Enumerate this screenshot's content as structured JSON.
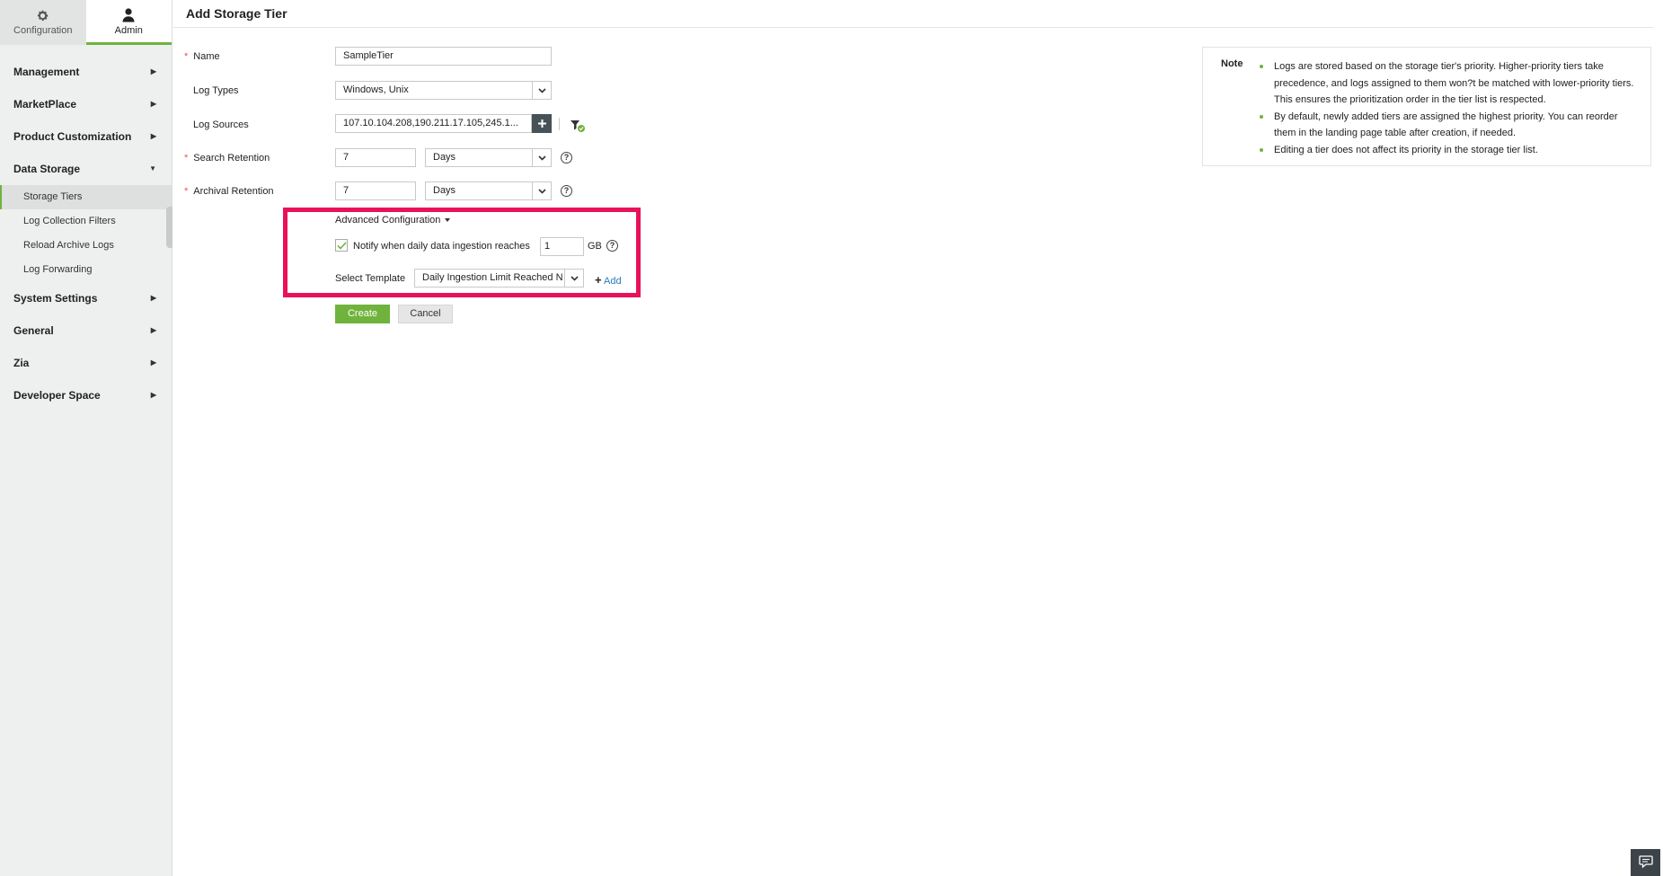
{
  "top_tabs": {
    "configuration": "Configuration",
    "admin": "Admin"
  },
  "nav": {
    "management": "Management",
    "marketplace": "MarketPlace",
    "product_customization": "Product Customization",
    "data_storage": "Data Storage",
    "sub": {
      "storage_tiers": "Storage Tiers",
      "log_collection_filters": "Log Collection Filters",
      "reload_archive_logs": "Reload Archive Logs",
      "log_forwarding": "Log Forwarding"
    },
    "system_settings": "System Settings",
    "general": "General",
    "zia": "Zia",
    "developer_space": "Developer Space"
  },
  "page": {
    "title": "Add Storage Tier"
  },
  "form": {
    "required_mark": "*",
    "name_label": "Name",
    "name_value": "SampleTier",
    "log_types_label": "Log Types",
    "log_types_value": "Windows, Unix",
    "log_sources_label": "Log Sources",
    "log_sources_value": "107.10.104.208,190.211.17.105,245.1...",
    "search_retention_label": "Search Retention",
    "search_retention_value": "7",
    "search_retention_unit": "Days",
    "archival_retention_label": "Archival Retention",
    "archival_retention_value": "7",
    "archival_retention_unit": "Days",
    "help_glyph": "?"
  },
  "advanced": {
    "title": "Advanced Configuration",
    "notify_label": "Notify when daily data ingestion reaches",
    "notify_checked": true,
    "notify_value": "1",
    "notify_unit": "GB",
    "template_label": "Select Template",
    "template_value": "Daily Ingestion Limit Reached N",
    "add_label": "Add",
    "add_glyph": "+"
  },
  "buttons": {
    "create": "Create",
    "cancel": "Cancel"
  },
  "note": {
    "title": "Note",
    "items": [
      "Logs are stored based on the storage tier's priority. Higher-priority tiers take precedence, and logs assigned to them won?t be matched with lower-priority tiers. This ensures the prioritization order in the tier list is respected.",
      "By default, newly added tiers are assigned the highest priority. You can reorder them in the landing page table after creation, if needed.",
      "Editing a tier does not affect its priority in the storage tier list."
    ]
  },
  "colors": {
    "accent_green": "#6fb33d",
    "highlight_pink": "#e8125c",
    "link_blue": "#2a7ab8"
  }
}
